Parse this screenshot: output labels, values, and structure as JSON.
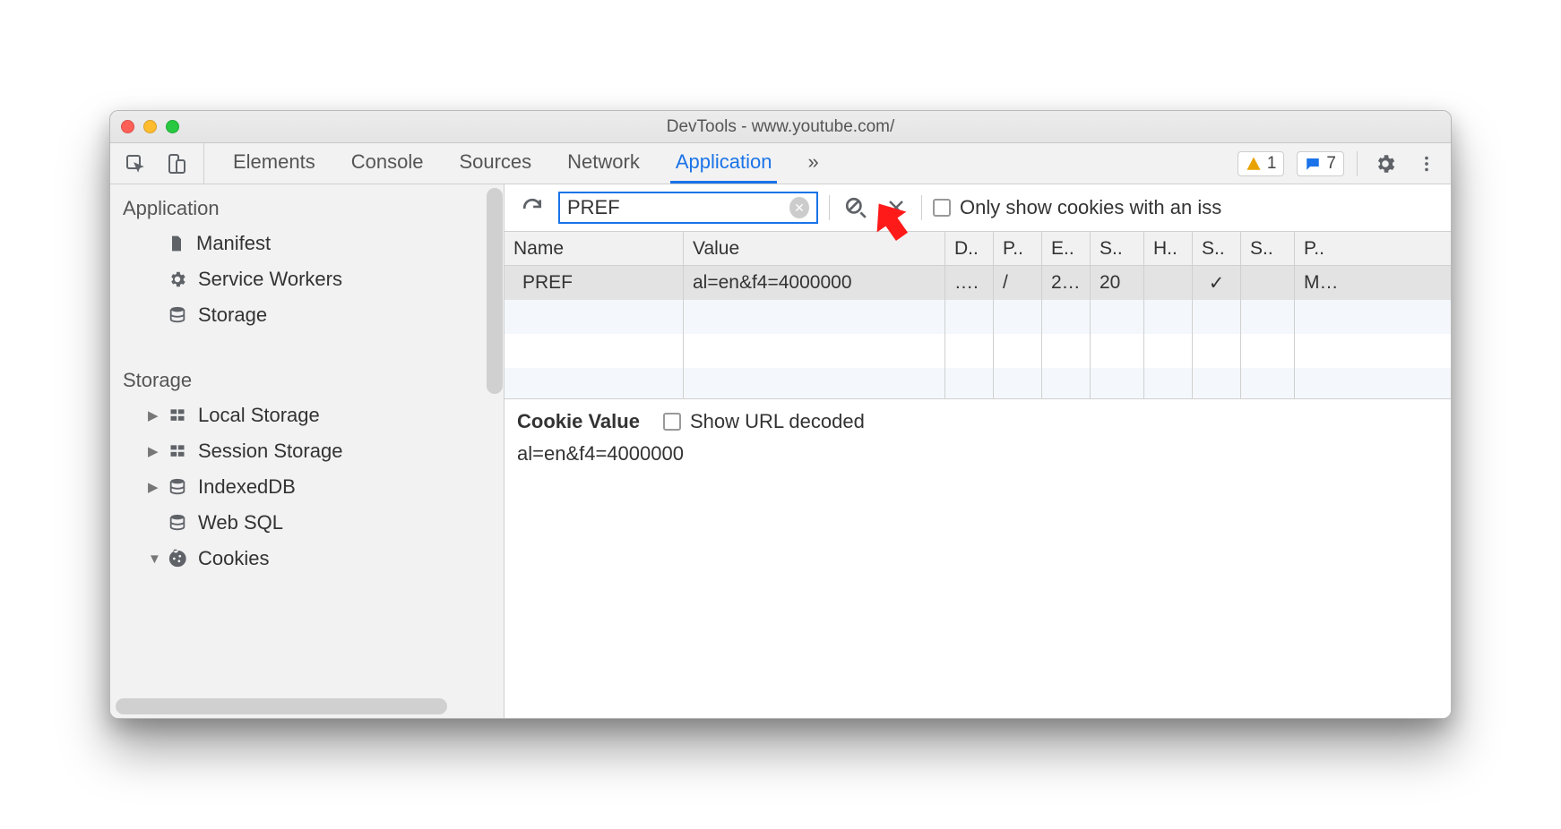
{
  "window": {
    "title": "DevTools - www.youtube.com/"
  },
  "tabs": {
    "items": [
      "Elements",
      "Console",
      "Sources",
      "Network",
      "Application"
    ],
    "active": "Application",
    "more": "»",
    "warn_count": "1",
    "info_count": "7"
  },
  "sidebar": {
    "sections": [
      {
        "heading": "Application",
        "items": [
          {
            "label": "Manifest",
            "icon": "file",
            "expand": null
          },
          {
            "label": "Service Workers",
            "icon": "gear",
            "expand": null
          },
          {
            "label": "Storage",
            "icon": "db",
            "expand": null
          }
        ]
      },
      {
        "heading": "Storage",
        "items": [
          {
            "label": "Local Storage",
            "icon": "grid",
            "expand": "▶"
          },
          {
            "label": "Session Storage",
            "icon": "grid",
            "expand": "▶"
          },
          {
            "label": "IndexedDB",
            "icon": "db",
            "expand": "▶"
          },
          {
            "label": "Web SQL",
            "icon": "db",
            "expand": null
          },
          {
            "label": "Cookies",
            "icon": "cookie",
            "expand": "▼"
          }
        ]
      }
    ]
  },
  "filter": {
    "value": "PREF"
  },
  "only_issue_label": "Only show cookies with an iss",
  "table": {
    "headers": [
      "Name",
      "Value",
      "D..",
      "P..",
      "E..",
      "S..",
      "H..",
      "S..",
      "S..",
      "P.."
    ],
    "row": {
      "name": "PREF",
      "value": "al=en&f4=4000000",
      "d": "….",
      "p": "/",
      "e": "2…",
      "s": "20",
      "h": "",
      "s2": "✓",
      "s3": "",
      "pr": "M…"
    }
  },
  "cookie_panel": {
    "heading": "Cookie Value",
    "show_decoded": "Show URL decoded",
    "value": "al=en&f4=4000000"
  }
}
